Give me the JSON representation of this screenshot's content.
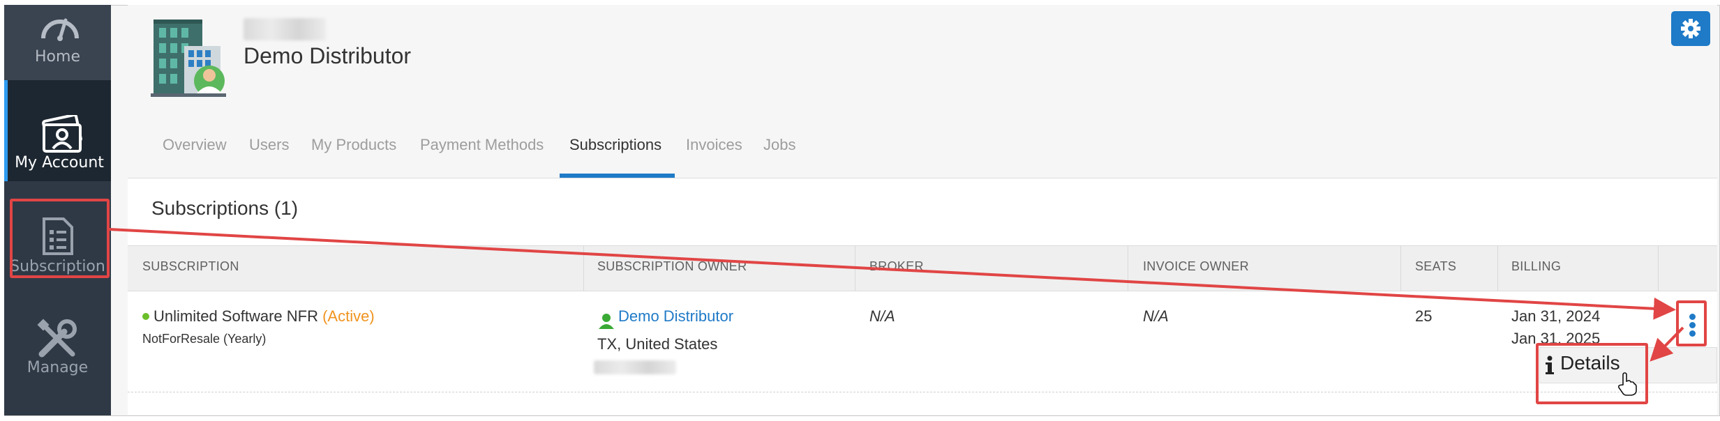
{
  "sidebar": {
    "items": [
      {
        "label": "Home",
        "icon": "speedometer-icon"
      },
      {
        "label": "My Account",
        "icon": "account-card-icon",
        "active": true
      },
      {
        "label": "Subscription",
        "icon": "document-list-icon"
      },
      {
        "label": "Manage",
        "icon": "tools-icon"
      }
    ]
  },
  "header": {
    "account_name": "Demo Distributor",
    "settings_icon": "gear-icon"
  },
  "tabs": [
    "Overview",
    "Users",
    "My Products",
    "Payment Methods",
    "Subscriptions",
    "Invoices",
    "Jobs"
  ],
  "active_tab": "Subscriptions",
  "section": {
    "title": "Subscriptions (1)"
  },
  "table": {
    "columns": [
      "SUBSCRIPTION",
      "SUBSCRIPTION OWNER",
      "BROKER",
      "INVOICE OWNER",
      "SEATS",
      "BILLING"
    ],
    "rows": [
      {
        "name": "Unlimited Software NFR",
        "status": "(Active)",
        "plan": "NotForResale (Yearly)",
        "owner": "Demo Distributor",
        "owner_location": "TX, United States",
        "broker": "N/A",
        "invoice_owner": "N/A",
        "seats": "25",
        "billing_start": "Jan 31, 2024",
        "billing_end": "Jan 31, 2025"
      }
    ]
  },
  "row_menu": {
    "details_label": "Details"
  },
  "colors": {
    "accent": "#1f7ac7",
    "active_status": "#f0931f",
    "annotation": "#e14545",
    "sidebar_bg": "#2b3541"
  }
}
